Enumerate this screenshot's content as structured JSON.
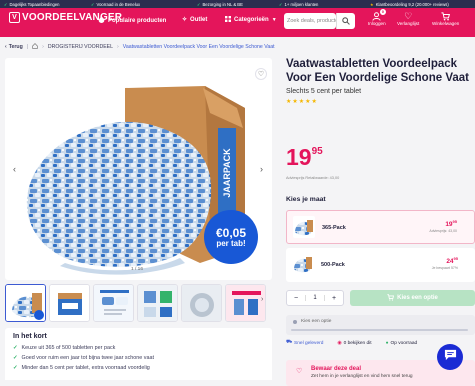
{
  "topbar": {
    "usps": [
      "Dagelijks Topaanbiedingen",
      "Voorraad in de Benelux",
      "Bezorging in NL & BE",
      "1+ miljoen klanten",
      "Klantbeoordeling 9,2 (20.000+ reviews)"
    ]
  },
  "header": {
    "logo_text": "VOORDEELVANGER",
    "nav": {
      "popular": "Populaire producten",
      "outlet": "Outlet",
      "categories": "Categorieën"
    },
    "search_placeholder": "Zoek deals, producten...",
    "login_label": "Inloggen",
    "login_badge": "0",
    "wishlist_label": "Verlanglijst",
    "cart_label": "Winkelwagen"
  },
  "breadcrumb": {
    "back": "Terug",
    "category": "DROGISTERIJ VOORDEEL",
    "current": "Vaatwastabletten Voordeelpack Voor Een Voordelige Schone Vaat"
  },
  "gallery": {
    "counter": "1 / 16",
    "box_text": "JAARPACK",
    "promo_big": "€0,05",
    "promo_small": "per tab!"
  },
  "summary": {
    "title": "In het kort",
    "items": [
      "Keuze uit 365 of 500 tabletten per pack",
      "Goed voor ruim een jaar tot bijna twee jaar schone vaat",
      "Minder dan 5 cent per tablet, extra voorraad voordelig"
    ]
  },
  "product": {
    "title": "Vaatwastabletten Voordeelpack Voor Een Voordelige Schone Vaat",
    "subtitle": "Slechts 5 cent per tablet",
    "rating_stars": 5,
    "price_main": "19",
    "price_cents": "95",
    "advies": "Adviesprijs Retailwaarde: 43,00"
  },
  "size": {
    "title": "Kies je maat",
    "options": [
      {
        "label": "365-Pack",
        "price_main": "19",
        "price_cents": "95",
        "advies": "Adviesprijs: 43,00"
      },
      {
        "label": "500-Pack",
        "price_main": "24",
        "price_cents": "95",
        "advies": "Je bespaart 57%"
      }
    ]
  },
  "purchase": {
    "qty_minus": "−",
    "qty_value": "1",
    "qty_plus": "+",
    "cta": "Kies een optie"
  },
  "kies_hint": "Kies een optie",
  "tags": {
    "delivery": "Snel geleverd",
    "viewers": "0 bekijken dit",
    "stock": "Op voorraad"
  },
  "deal": {
    "title": "Bewaar deze deal",
    "text": "Zet hem in je verlanglijst en vind hem snel terug"
  },
  "colors": {
    "brand": "#e4155b",
    "topbar": "#2b2d4f",
    "accent_blue": "#1858d6",
    "cta_disabled": "#b7e3c4",
    "stars": "#f5b700"
  }
}
